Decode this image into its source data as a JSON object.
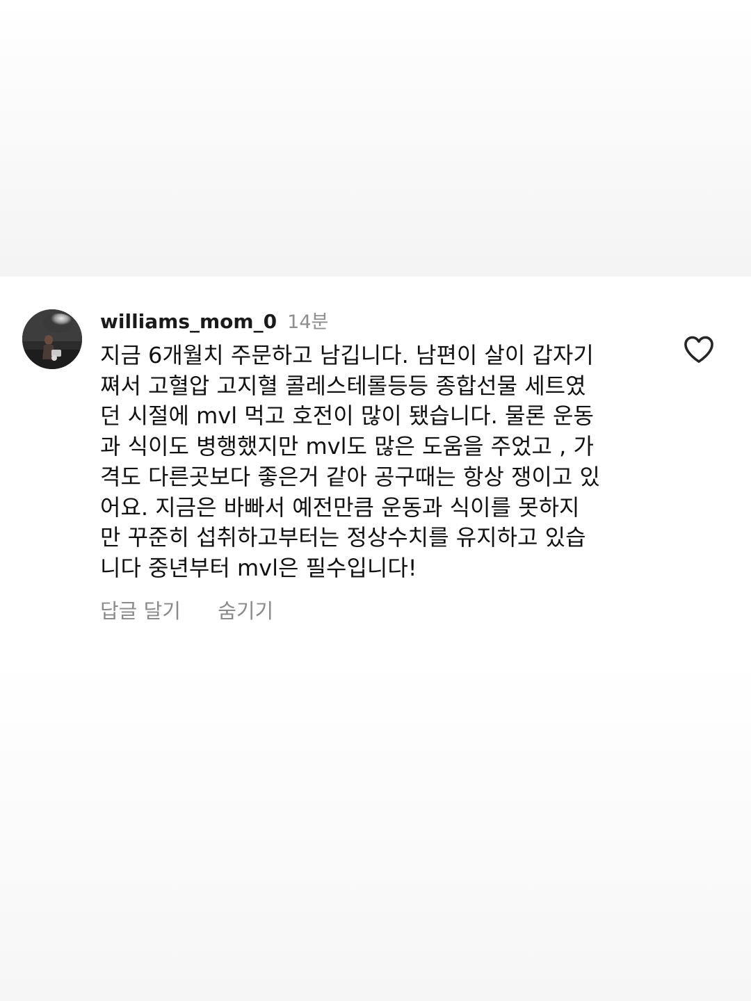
{
  "comment": {
    "username": "williams_mom_0",
    "time": "14분",
    "lines": [
      "지금 6개월치 주문하고 남깁니다. 남편이 살이 갑자기",
      "쪄서 고혈압 고지혈 콜레스테롤등등 종합선물 세트였",
      "던 시절에 mvl 먹고 호전이 많이 됐습니다. 물론 운동",
      "과 식이도 병행했지만 mvl도 많은 도움을 주었고 , 가",
      "격도 다른곳보다 좋은거 같아 공구때는 항상 쟁이고 있",
      "어요. 지금은 바빠서 예전만큼 운동과 식이를 못하지",
      "만 꾸준히 섭취하고부터는 정상수치를 유지하고 있습",
      "니다  중년부터 mvl은 필수입니다!"
    ],
    "reply_label": "답글 달기",
    "hide_label": "숨기기"
  },
  "icons": {
    "like": "heart-outline-icon",
    "avatar": "profile-photo"
  },
  "colors": {
    "text": "#111111",
    "secondary_text": "#8e8e8e",
    "background": "#ffffff"
  }
}
